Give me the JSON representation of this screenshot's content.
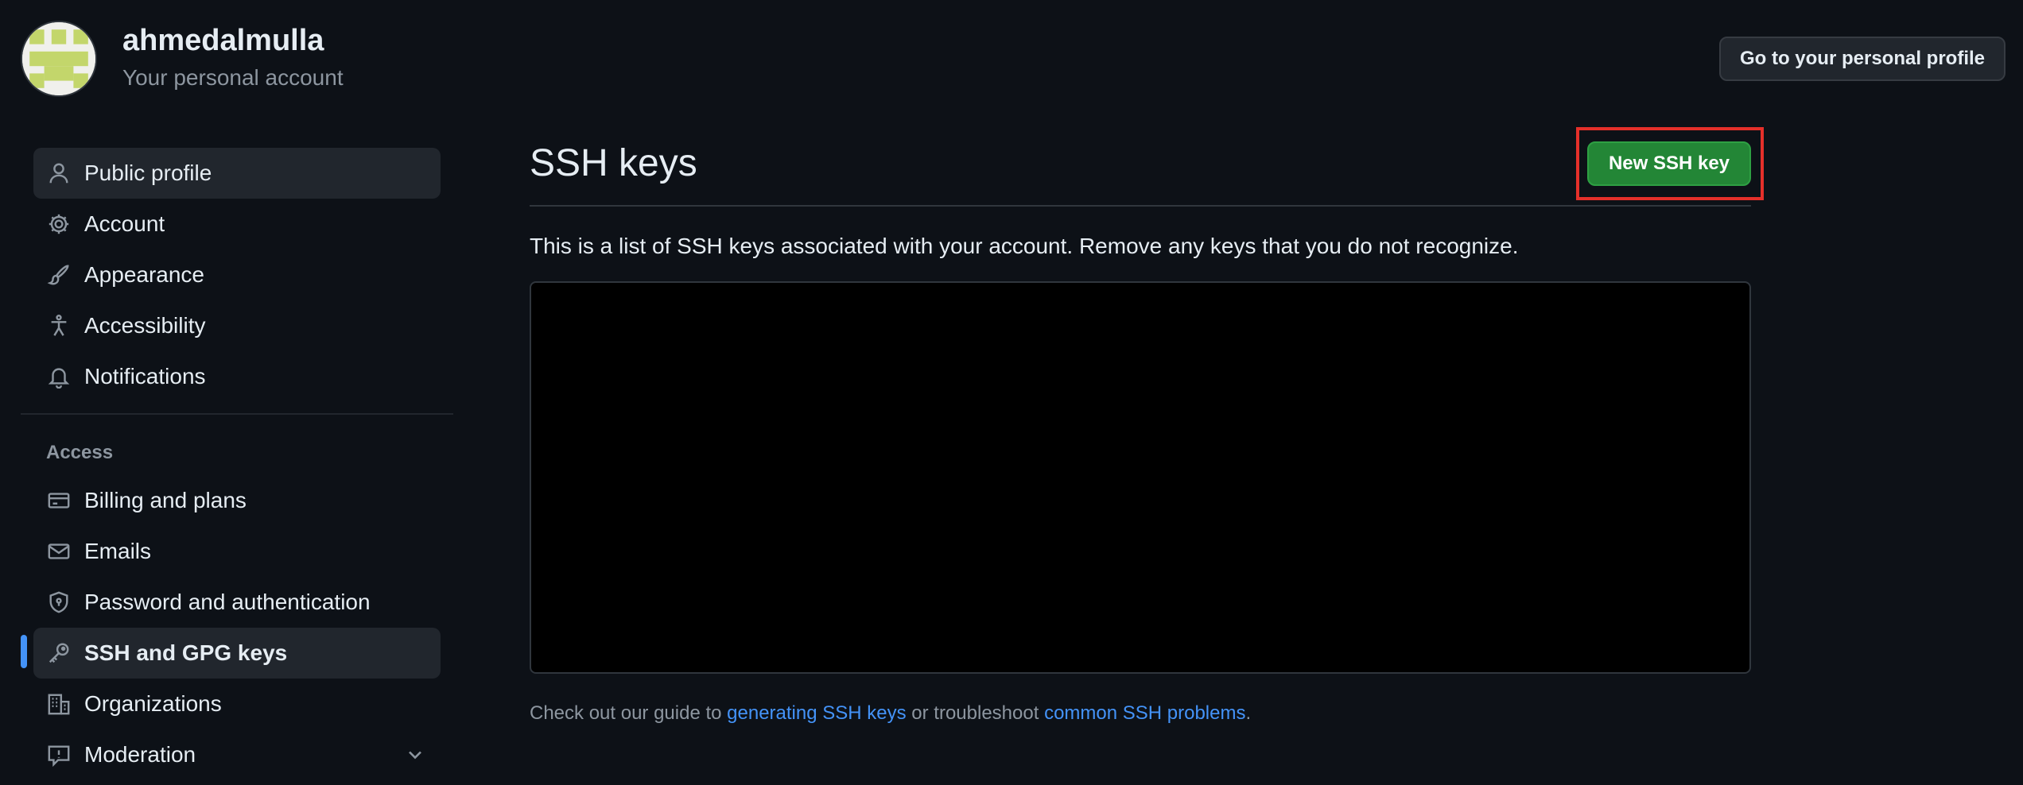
{
  "header": {
    "username": "ahmedalmulla",
    "account_type": "Your personal account",
    "profile_button": "Go to your personal profile"
  },
  "sidebar": {
    "items": [
      {
        "label": "Public profile",
        "icon": "person-icon"
      },
      {
        "label": "Account",
        "icon": "gear-icon"
      },
      {
        "label": "Appearance",
        "icon": "paintbrush-icon"
      },
      {
        "label": "Accessibility",
        "icon": "accessibility-icon"
      },
      {
        "label": "Notifications",
        "icon": "bell-icon"
      }
    ],
    "access_section": "Access",
    "access_items": [
      {
        "label": "Billing and plans",
        "icon": "credit-card-icon"
      },
      {
        "label": "Emails",
        "icon": "mail-icon"
      },
      {
        "label": "Password and authentication",
        "icon": "shield-lock-icon"
      },
      {
        "label": "SSH and GPG keys",
        "icon": "key-icon"
      },
      {
        "label": "Organizations",
        "icon": "organization-icon"
      },
      {
        "label": "Moderation",
        "icon": "report-icon"
      }
    ]
  },
  "main": {
    "title": "SSH keys",
    "new_key_button": "New SSH key",
    "description": "This is a list of SSH keys associated with your account. Remove any keys that you do not recognize.",
    "footer_prefix": "Check out our guide to ",
    "footer_link1": "generating SSH keys",
    "footer_mid": " or troubleshoot ",
    "footer_link2": "common SSH problems",
    "footer_suffix": "."
  },
  "colors": {
    "background": "#0d1117",
    "accent_blue": "#4493f8",
    "button_green": "#238636",
    "highlight_red": "#e5302a"
  }
}
